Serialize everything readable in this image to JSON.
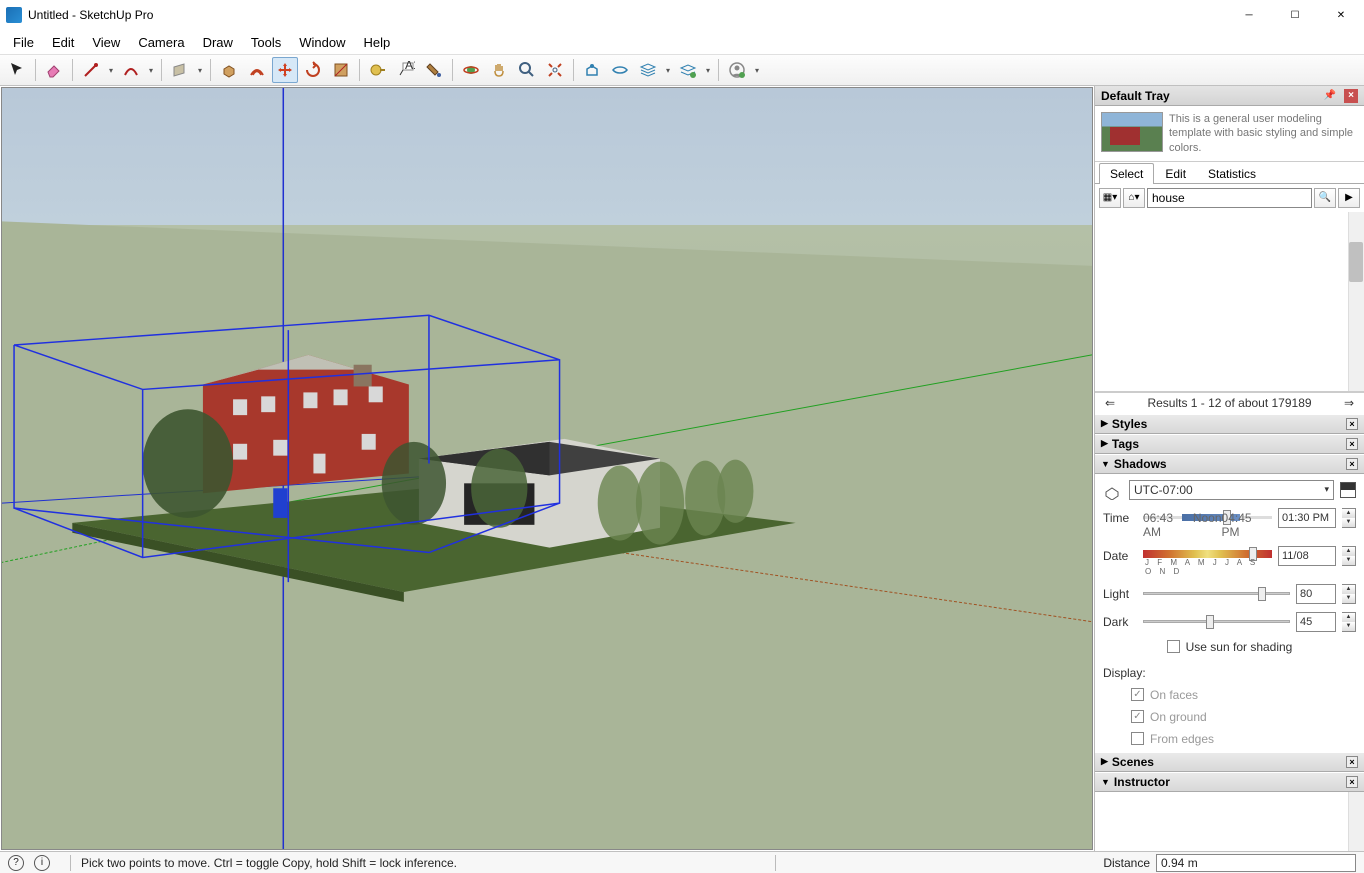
{
  "title": "Untitled - SketchUp Pro",
  "menus": [
    "File",
    "Edit",
    "View",
    "Camera",
    "Draw",
    "Tools",
    "Window",
    "Help"
  ],
  "tray": {
    "title": "Default Tray",
    "description": "This is a general user modeling template with basic styling and simple colors.",
    "tabs": [
      "Select",
      "Edit",
      "Statistics"
    ],
    "search_value": "house",
    "results_text": "Results 1 - 12 of about 179189",
    "panels": {
      "styles": "Styles",
      "tags": "Tags",
      "shadows": "Shadows",
      "scenes": "Scenes",
      "instructor": "Instructor"
    }
  },
  "shadows": {
    "timezone": "UTC-07:00",
    "time_label": "Time",
    "time_start": "06:43 AM",
    "time_mid": "Noon",
    "time_end": "04:45 PM",
    "time_value": "01:30 PM",
    "date_label": "Date",
    "date_months": "J F M A M J J A S O N D",
    "date_value": "11/08",
    "light_label": "Light",
    "light_value": "80",
    "dark_label": "Dark",
    "dark_value": "45",
    "sun_label": "Use sun for shading",
    "display_label": "Display:",
    "on_faces": "On faces",
    "on_ground": "On ground",
    "from_edges": "From edges"
  },
  "status": {
    "hint": "Pick two points to move.  Ctrl = toggle Copy, hold Shift = lock inference.",
    "distance_label": "Distance",
    "distance_value": "0.94 m"
  }
}
